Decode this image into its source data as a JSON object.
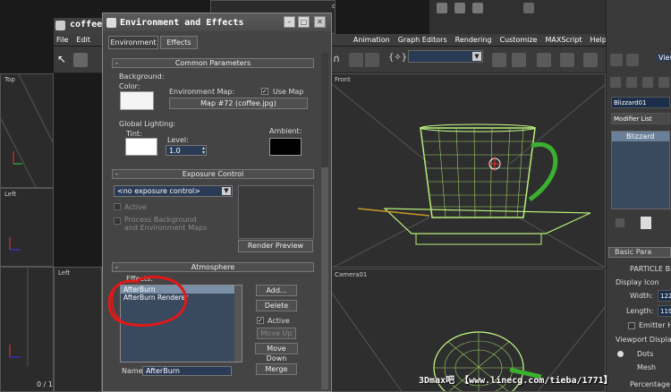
{
  "main_window": {
    "title_fragment": "coffee",
    "menus": [
      "File",
      "Edit",
      "Animation",
      "Graph Editors",
      "Rendering",
      "Customize",
      "MAXScript",
      "Help"
    ],
    "view_label": "View"
  },
  "viewports": {
    "top": "Top",
    "left": "Left",
    "left2": "Left",
    "front": "Front",
    "camera": "Camera01",
    "top_partial": "op"
  },
  "frame_counter": "0 / 1",
  "command_panel": {
    "object_name": "Blizzard01",
    "modifier_list": "Modifier List",
    "stack_item": "Blizzard",
    "basic_params": "Basic Para",
    "particle_label": "PARTICLE BL",
    "display_icon": "Display Icon",
    "width_label": "Width:",
    "width_value": "122",
    "length_label": "Length:",
    "length_value": "119",
    "emitter_label": "Emitter H",
    "viewport_display": "Viewport Display",
    "dots_label": "Dots",
    "mesh_label": "Mesh",
    "percentage_label": "Percentage o"
  },
  "env_dialog": {
    "title": "Environment and Effects",
    "tabs": [
      "Environment",
      "Effects"
    ],
    "common_params": "Common Parameters",
    "background_label": "Background:",
    "color_label": "Color:",
    "env_map_label": "Environment Map:",
    "use_map_label": "Use Map",
    "use_map_checked": true,
    "map_button": "Map #72 (coffee.jpg)",
    "global_lighting": "Global Lighting:",
    "tint_label": "Tint:",
    "level_label": "Level:",
    "level_value": "1.0",
    "ambient_label": "Ambient:",
    "exposure_control": "Exposure Control",
    "exposure_dropdown": "<no exposure control>",
    "active_label": "Active",
    "process_bg_label": "Process Background",
    "env_maps_label": "and Environment Maps",
    "render_preview": "Render Preview",
    "atmosphere": "Atmosphere",
    "effects_label": "Effects:",
    "effects": [
      "AfterBurn",
      "AfterBurn Renderer"
    ],
    "add_button": "Add...",
    "delete_button": "Delete",
    "active2_label": "Active",
    "active2_checked": true,
    "move_up_button": "Move Up",
    "move_down_button": "Move Down",
    "name_label": "Name:",
    "name_value": "AfterBurn",
    "merge_button": "Merge"
  },
  "watermark": "3Dmax吧 【www.linecg.com/tieba/1771】",
  "colors": {
    "wireframe": "#b7f07a",
    "handle": "#3cae30",
    "annotation": "#e01818",
    "listbox_bg": "#3a4a5e"
  }
}
